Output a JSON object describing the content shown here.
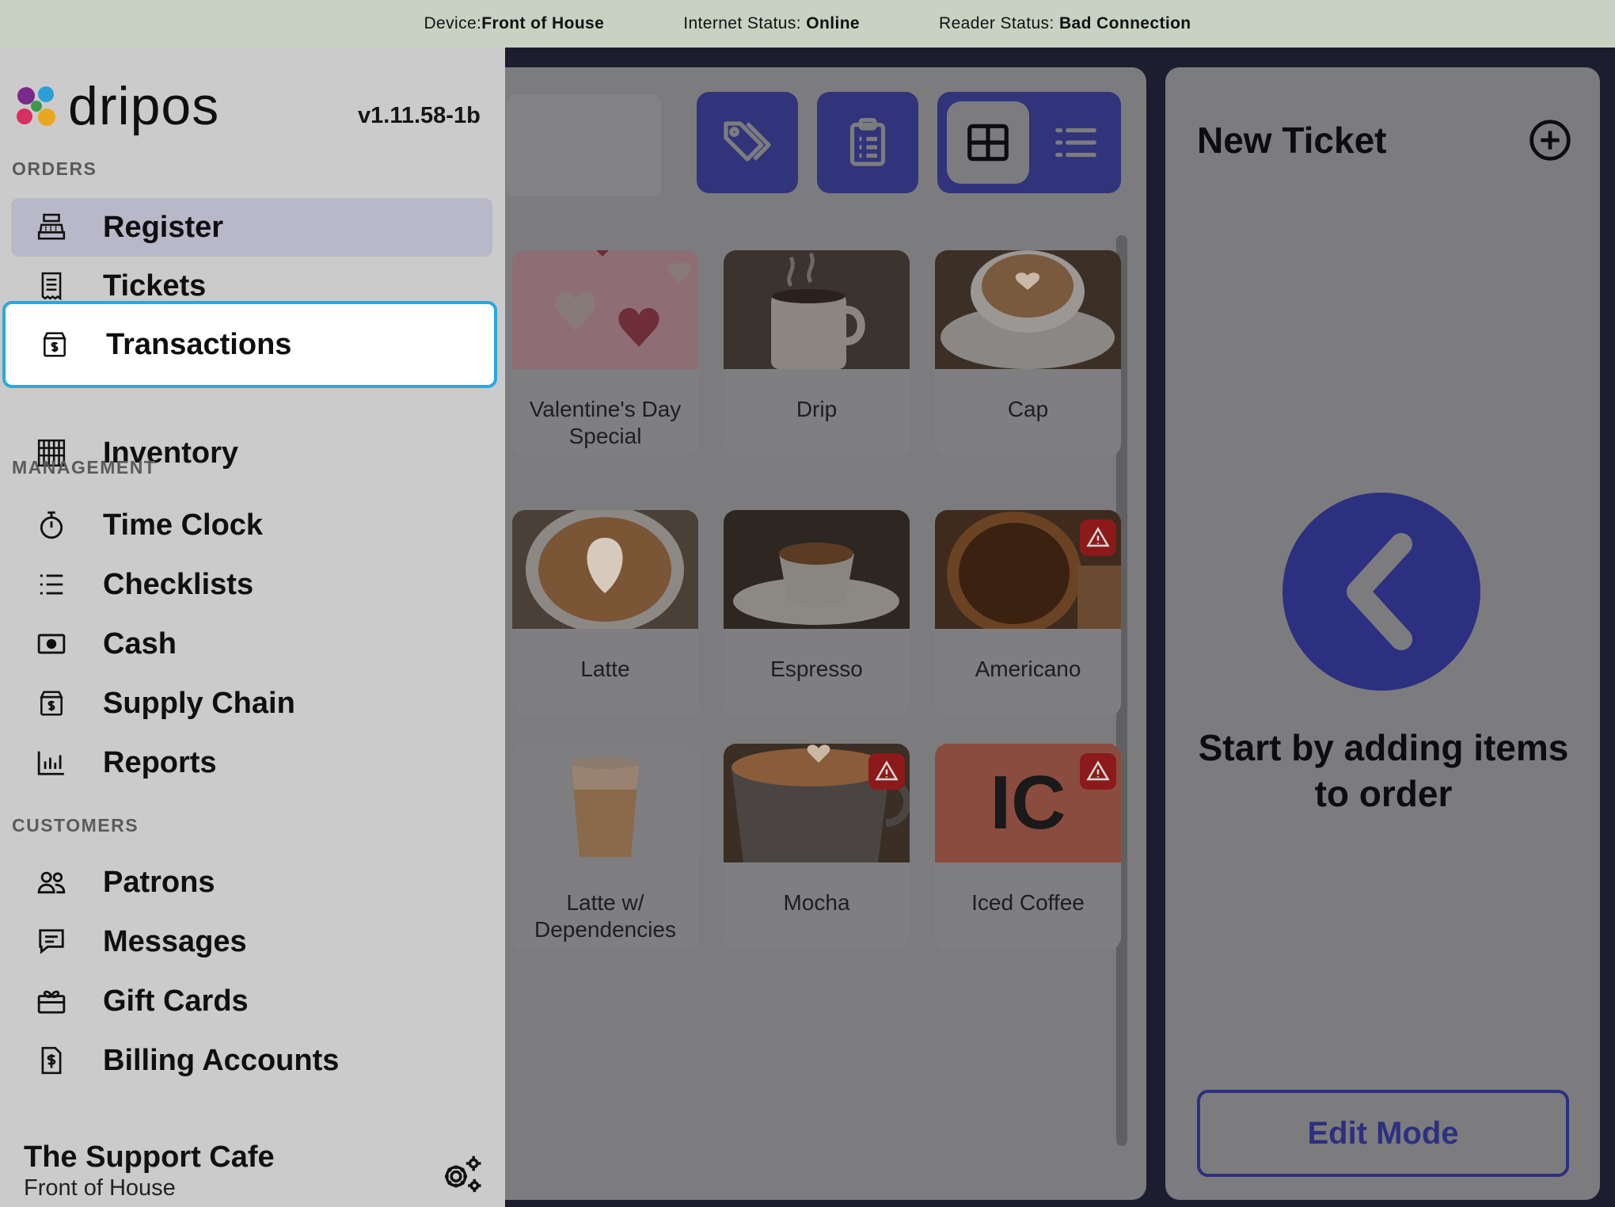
{
  "status_bar": {
    "device_label": "Device:",
    "device_value": "Front of House",
    "internet_label": "Internet Status: ",
    "internet_value": "Online",
    "reader_label": "Reader Status: ",
    "reader_value": "Bad Connection"
  },
  "sidebar": {
    "logo_text": "dripos",
    "version": "v1.11.58-1b",
    "sections": {
      "orders": "ORDERS",
      "management": "MANAGEMENT",
      "customers": "CUSTOMERS"
    },
    "items": [
      {
        "label": "Register",
        "icon": "cash-register-icon",
        "state": "active"
      },
      {
        "label": "Tickets",
        "icon": "receipt-icon"
      },
      {
        "label": "Transactions",
        "icon": "transaction-box-icon",
        "state": "focused"
      },
      {
        "label": "Inventory",
        "icon": "abacus-icon"
      },
      {
        "label": "Time Clock",
        "icon": "stopwatch-icon"
      },
      {
        "label": "Checklists",
        "icon": "list-icon"
      },
      {
        "label": "Cash",
        "icon": "banknote-icon"
      },
      {
        "label": "Supply Chain",
        "icon": "box-dollar-icon"
      },
      {
        "label": "Reports",
        "icon": "bar-chart-icon"
      },
      {
        "label": "Patrons",
        "icon": "users-icon"
      },
      {
        "label": "Messages",
        "icon": "message-icon"
      },
      {
        "label": "Gift Cards",
        "icon": "gift-card-icon"
      },
      {
        "label": "Billing Accounts",
        "icon": "invoice-icon"
      }
    ],
    "footer": {
      "location_name": "The Support Cafe",
      "device_name": "Front of House"
    }
  },
  "products": [
    {
      "name": "Valentine's Day Special",
      "warning": false
    },
    {
      "name": "Drip",
      "warning": false
    },
    {
      "name": "Cap",
      "warning": false
    },
    {
      "name": "Latte",
      "warning": false
    },
    {
      "name": "Espresso",
      "warning": false
    },
    {
      "name": "Americano",
      "warning": true
    },
    {
      "name": "Latte w/ Dependencies",
      "warning": false
    },
    {
      "name": "Mocha",
      "warning": true
    },
    {
      "name": "Iced Coffee",
      "warning": true,
      "initials": "IC"
    }
  ],
  "ticket": {
    "title": "New Ticket",
    "empty_message": "Start by adding items to order",
    "edit_button": "Edit Mode"
  },
  "colors": {
    "brand": "#31347a",
    "focus_ring": "#29a8e0",
    "warning": "#8c1a1a",
    "status_bar": "#c7d2c3"
  }
}
